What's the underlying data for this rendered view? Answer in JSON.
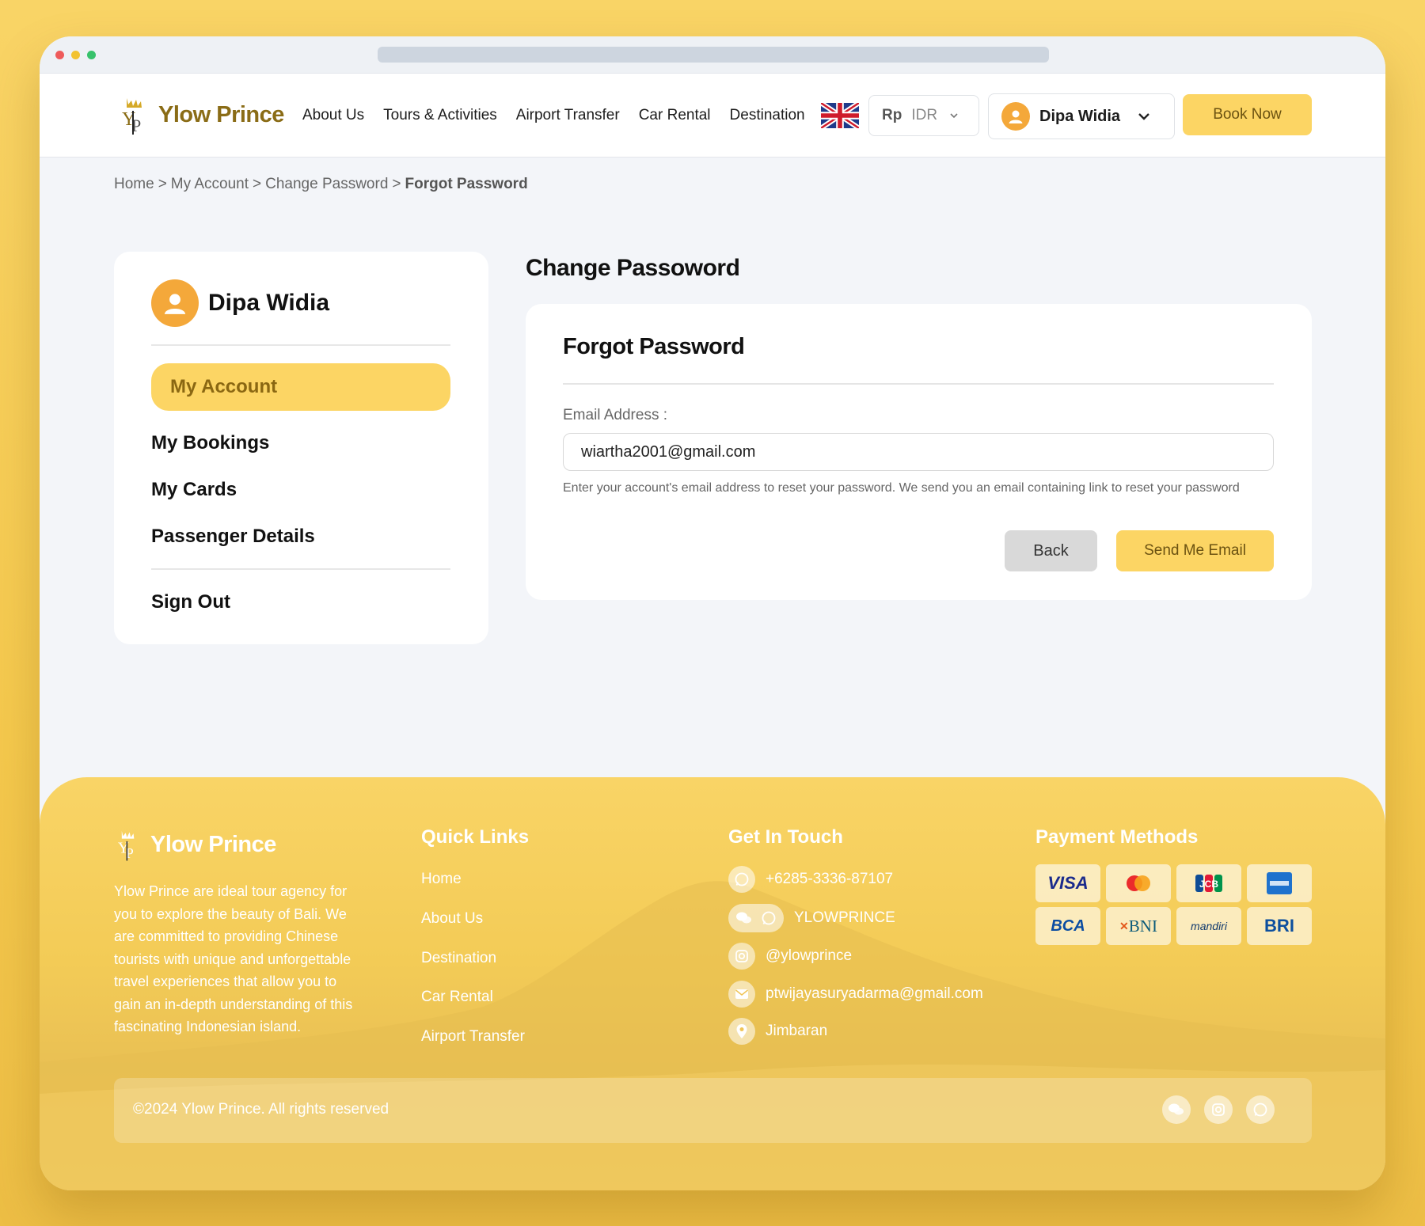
{
  "brand": {
    "name": "Ylow Prince"
  },
  "nav": {
    "links": [
      "About Us",
      "Tours & Activities",
      "Airport Transfer",
      "Car Rental",
      "Destination"
    ],
    "language_flag": "uk-flag-icon",
    "currency_symbol": "Rp",
    "currency_code": "IDR",
    "user_name": "Dipa Widia",
    "book_now": "Book Now"
  },
  "breadcrumb": {
    "items": [
      "Home",
      "My Account",
      "Change Password"
    ],
    "current": "Forgot Password",
    "separator": ">"
  },
  "sidebar": {
    "user_name": "Dipa Widia",
    "items": [
      "My Account",
      "My Bookings",
      "My Cards",
      "Passenger Details"
    ],
    "active": "My Account",
    "sign_out": "Sign Out"
  },
  "main": {
    "section_title": "Change Passoword",
    "form": {
      "title": "Forgot Password",
      "email_label": "Email Address :",
      "email_value": "wiartha2001@gmail.com",
      "help_text": "Enter your account's email address to reset your password. We send you an email containing link to reset your password",
      "back_label": "Back",
      "send_label": "Send Me Email"
    }
  },
  "footer": {
    "brand": "Ylow Prince",
    "about": "Ylow Prince are ideal tour agency for you to explore the beauty of Bali. We are committed to providing Chinese tourists with unique and unforgettable travel experiences that allow you to gain an in-depth understanding of this fascinating Indonesian island.",
    "quick_links_title": "Quick Links",
    "quick_links": [
      "Home",
      "About Us",
      "Destination",
      "Car Rental",
      "Airport Transfer"
    ],
    "contact_title": "Get In Touch",
    "contacts": {
      "phone": "+6285-3336-87107",
      "wechat_whatsapp": "YLOWPRINCE",
      "instagram": "@ylowprince",
      "email": "ptwijayasuryadarma@gmail.com",
      "location": "Jimbaran"
    },
    "payment_title": "Payment Methods",
    "payments": [
      "VISA",
      "mastercard",
      "JCB",
      "AMEX",
      "BCA",
      "BNI",
      "mandiri",
      "BRI"
    ],
    "copyright": "©2024 Ylow Prince. All rights reserved"
  },
  "colors": {
    "accent": "#fcd564",
    "brand_text": "#8a6c16",
    "avatar": "#f4a83a",
    "footer_bg": "#f5c94d"
  }
}
